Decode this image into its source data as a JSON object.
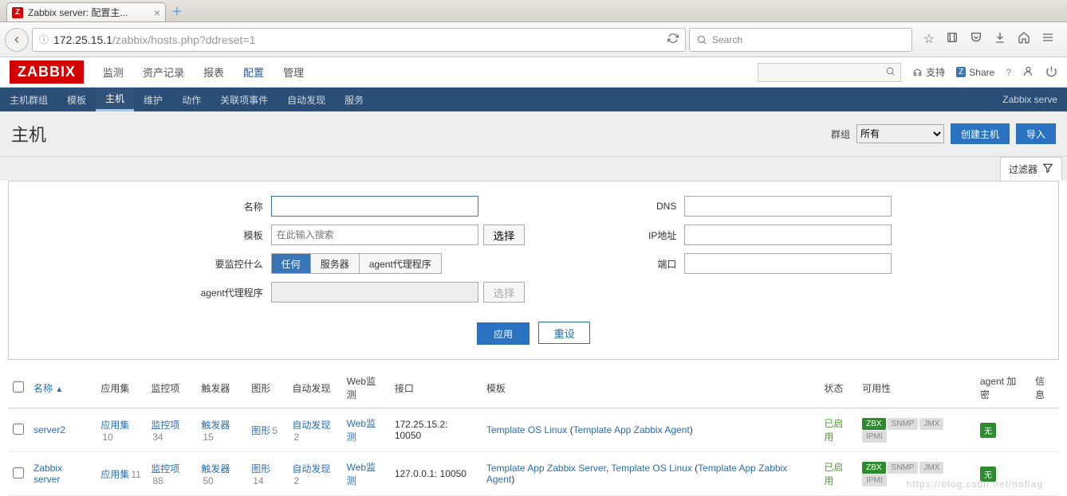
{
  "browser": {
    "tab_title": "Zabbix server: 配置主...",
    "url_host": "172.25.15.1",
    "url_path": "/zabbix/hosts.php?ddreset=1",
    "search_placeholder": "Search"
  },
  "topnav": {
    "logo": "ZABBIX",
    "items": [
      "监测",
      "资产记录",
      "报表",
      "配置",
      "管理"
    ],
    "active_index": 3,
    "support": "支持",
    "share": "Share"
  },
  "subnav": {
    "items": [
      "主机群组",
      "模板",
      "主机",
      "维护",
      "动作",
      "关联项事件",
      "自动发现",
      "服务"
    ],
    "active_index": 2,
    "breadcrumb": "Zabbix serve"
  },
  "page": {
    "title": "主机",
    "group_label": "群组",
    "group_value": "所有",
    "create_btn": "创建主机",
    "import_btn": "导入",
    "filter_tab": "过滤器"
  },
  "filter": {
    "name_label": "名称",
    "template_label": "模板",
    "template_placeholder": "在此输入搜索",
    "select_btn": "选择",
    "monitor_label": "要监控什么",
    "monitor_options": [
      "任何",
      "服务器",
      "agent代理程序"
    ],
    "monitor_active": 0,
    "proxy_label": "agent代理程序",
    "dns_label": "DNS",
    "ip_label": "IP地址",
    "port_label": "端口",
    "apply_btn": "应用",
    "reset_btn": "重设"
  },
  "table": {
    "headers": {
      "name": "名称",
      "apps": "应用集",
      "items": "监控项",
      "triggers": "触发器",
      "graphs": "图形",
      "discovery": "自动发现",
      "web": "Web监测",
      "iface": "接口",
      "templates": "模板",
      "status": "状态",
      "avail": "可用性",
      "agent_enc": "agent 加密",
      "info": "信息"
    },
    "rows": [
      {
        "name": "server2",
        "apps_label": "应用集",
        "apps_n": "10",
        "items_label": "监控项",
        "items_n": "34",
        "trig_label": "触发器",
        "trig_n": "15",
        "graph_label": "图形",
        "graph_n": "5",
        "disc_label": "自动发现",
        "disc_n": "2",
        "web_label": "Web监测",
        "iface": "172.25.15.2: 10050",
        "templates": "Template OS Linux (Template App Zabbix Agent)",
        "templates_parts": [
          "Template OS Linux",
          " (",
          "Template App Zabbix Agent",
          ")"
        ],
        "status": "已启用",
        "enc": "无"
      },
      {
        "name": "Zabbix server",
        "apps_label": "应用集",
        "apps_n": "11",
        "items_label": "监控项",
        "items_n": "88",
        "trig_label": "触发器",
        "trig_n": "50",
        "graph_label": "图形",
        "graph_n": "14",
        "disc_label": "自动发现",
        "disc_n": "2",
        "web_label": "Web监测",
        "iface": "127.0.0.1: 10050",
        "templates": "Template App Zabbix Server, Template OS Linux (Template App Zabbix Agent)",
        "templates_parts": [
          "Template App Zabbix Server",
          ", ",
          "Template OS Linux",
          " (",
          "Template App Zabbix Agent",
          ")"
        ],
        "status": "已启用",
        "enc": "无"
      }
    ],
    "avail_badges": [
      "ZBX",
      "SNMP",
      "JMX",
      "IPMI"
    ]
  },
  "watermark": "https://blog.csdn.net/noflag"
}
